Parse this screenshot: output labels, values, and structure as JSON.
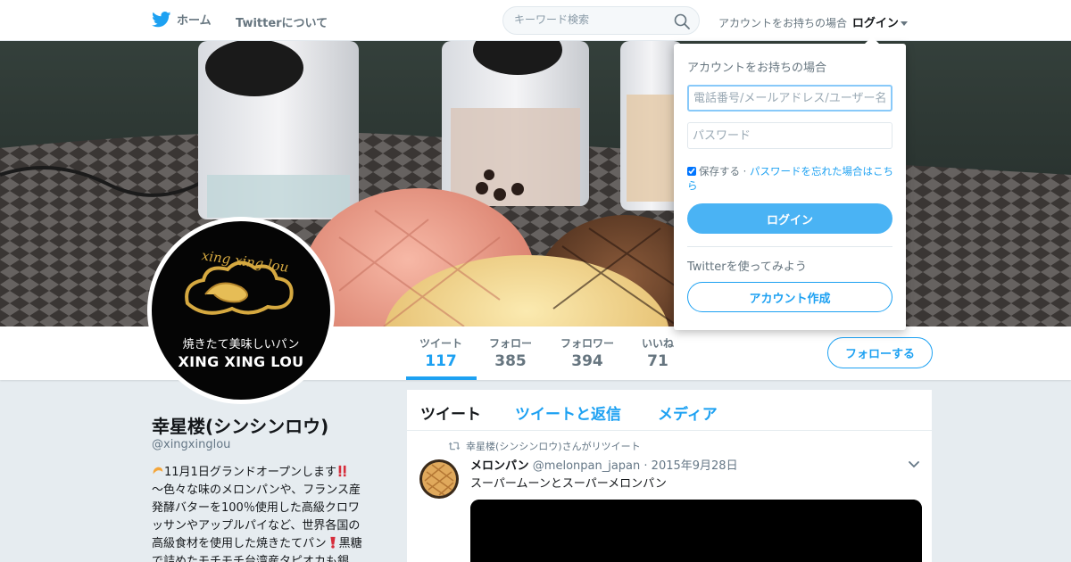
{
  "topbar": {
    "home_label": "ホーム",
    "about_label": "Twitterについて",
    "search_placeholder": "キーワード検索",
    "login_prompt": "アカウントをお持ちの場合",
    "login_label": "ログイン",
    "brand_color": "#1da1f2"
  },
  "profile_nav": {
    "stats": [
      {
        "label": "ツイート",
        "value": "117"
      },
      {
        "label": "フォロー",
        "value": "385"
      },
      {
        "label": "フォロワー",
        "value": "394"
      },
      {
        "label": "いいね",
        "value": "71"
      }
    ],
    "follow_button": "フォローする"
  },
  "avatar": {
    "logo_script": "xing xing lou",
    "tagline": "焼きたて美味しいパン",
    "name": "XING XING LOU"
  },
  "profile": {
    "name": "幸星楼(シンシンロウ)",
    "handle": "@xingxinglou",
    "bio_line1": "11月1日グランドオープンします",
    "bio_line2": "～色々な味のメロンパンや、フランス産",
    "bio_line3": "発酵バターを100％使用した高級クロワ",
    "bio_line4": "ッサンやアップルパイなど、世界各国の",
    "bio_line5": "高級食材を使用した焼きたてパン",
    "bio_line5_tail": "黒糖",
    "bio_line6": "で詰めたモチモチ台湾産タピオカも銀"
  },
  "timeline": {
    "tabs": [
      "ツイート",
      "ツイートと返信",
      "メディア"
    ],
    "retweet_note": "幸星楼(シンシンロウ)さんがリツイート",
    "tweet": {
      "name": "メロンパン",
      "handle": "@melonpan_japan",
      "date": "· 2015年9月28日",
      "text": "スーパームーンとスーパーメロンパン"
    }
  },
  "login_dropdown": {
    "title": "アカウントをお持ちの場合",
    "username_placeholder": "電話番号/メールアドレス/ユーザー名",
    "password_placeholder": "パスワード",
    "remember_label": "保存する ·",
    "forgot_link": "パスワードを忘れた場合はこちら",
    "login_button": "ログイン",
    "signup_title": "Twitterを使ってみよう",
    "signup_button": "アカウント作成"
  }
}
